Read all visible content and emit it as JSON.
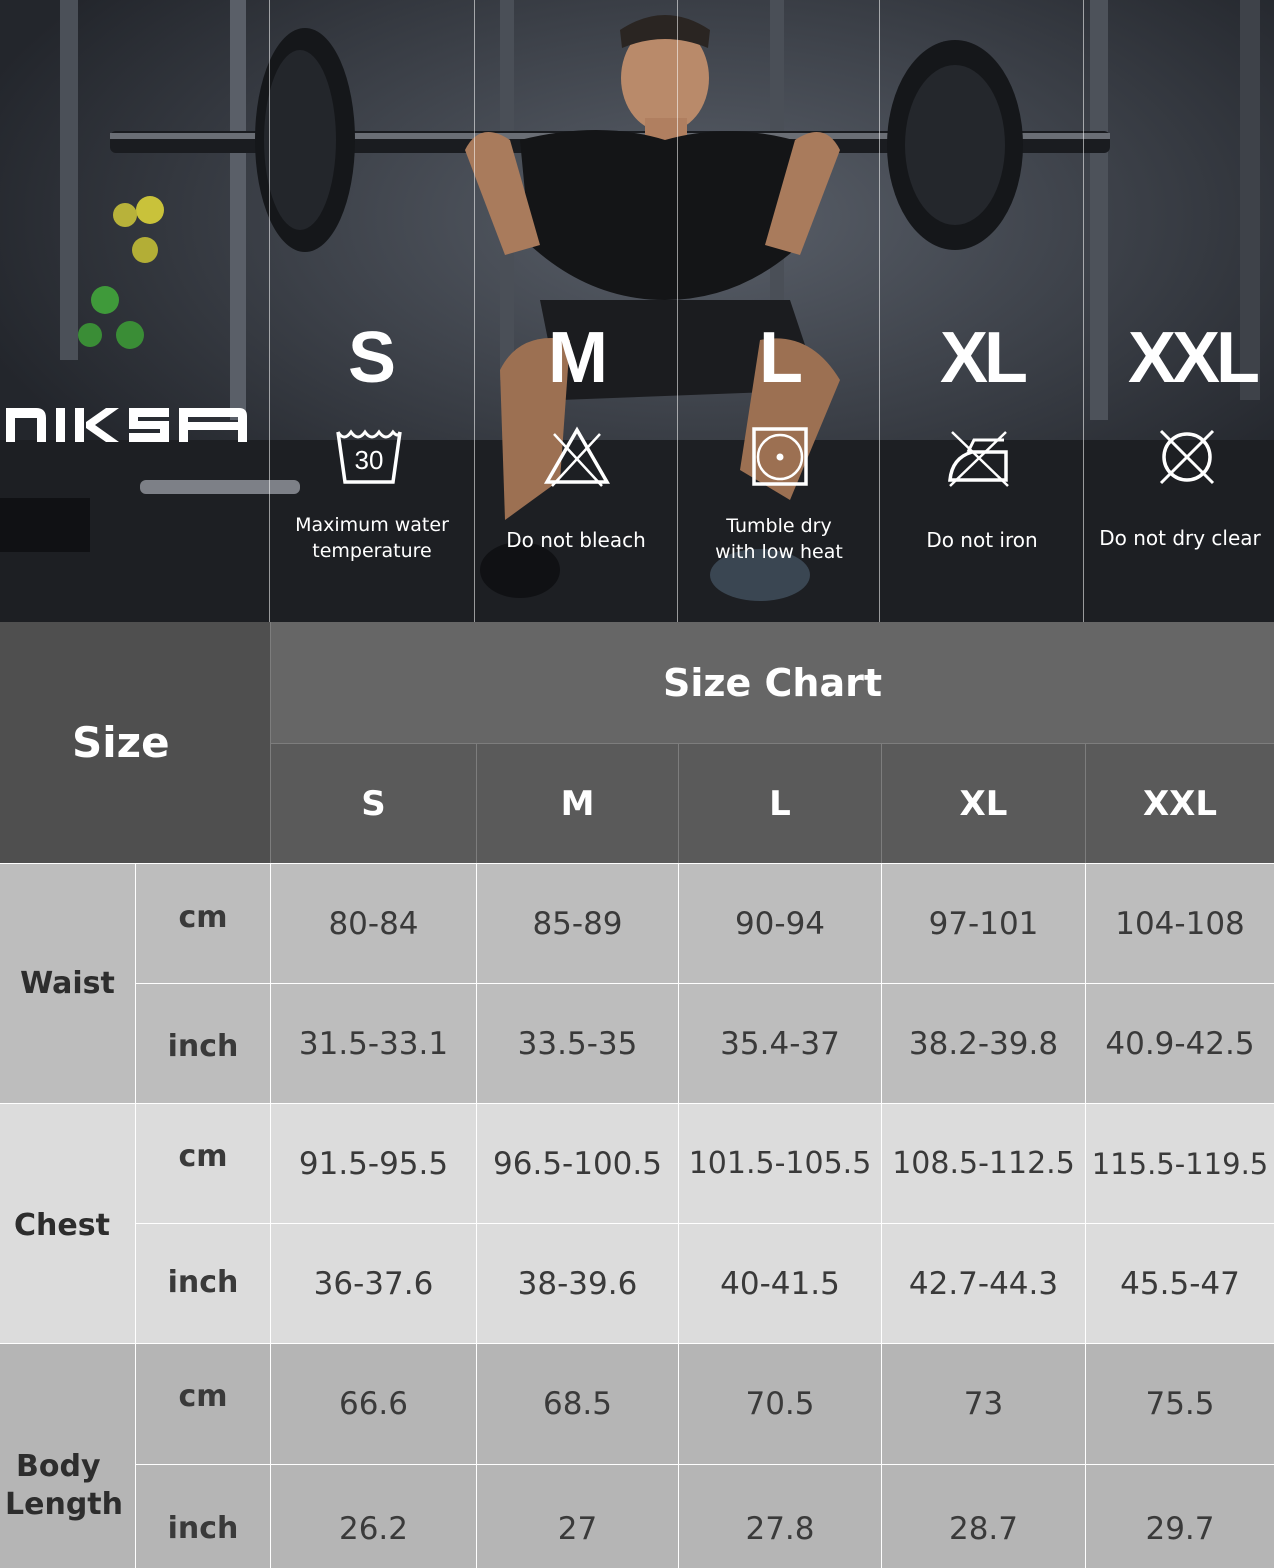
{
  "brand": {
    "logo_text": "NIKSA"
  },
  "hero": {
    "sizes": [
      "S",
      "M",
      "L",
      "XL",
      "XXL"
    ],
    "care": [
      {
        "icon": "wash-30-icon",
        "line1": "Maximum water",
        "line2": "temperature",
        "badge": "30"
      },
      {
        "icon": "do-not-bleach-icon",
        "line1": "Do not bleach",
        "line2": ""
      },
      {
        "icon": "tumble-dry-low-icon",
        "line1": "Tumble dry",
        "line2": "with low heat"
      },
      {
        "icon": "do-not-iron-icon",
        "line1": "Do not iron",
        "line2": ""
      },
      {
        "icon": "do-not-dry-clean-icon",
        "line1": "Do not dry clear",
        "line2": ""
      }
    ]
  },
  "table": {
    "title": "Size Chart",
    "size_label": "Size",
    "columns": [
      "S",
      "M",
      "L",
      "XL",
      "XXL"
    ],
    "groups": [
      {
        "name": "Waist",
        "rows": [
          {
            "unit": "cm",
            "values": [
              "80-84",
              "85-89",
              "90-94",
              "97-101",
              "104-108"
            ]
          },
          {
            "unit": "inch",
            "values": [
              "31.5-33.1",
              "33.5-35",
              "35.4-37",
              "38.2-39.8",
              "40.9-42.5"
            ]
          }
        ]
      },
      {
        "name": "Chest",
        "rows": [
          {
            "unit": "cm",
            "values": [
              "91.5-95.5",
              "96.5-100.5",
              "101.5-105.5",
              "108.5-112.5",
              "115.5-119.5"
            ]
          },
          {
            "unit": "inch",
            "values": [
              "36-37.6",
              "38-39.6",
              "40-41.5",
              "42.7-44.3",
              "45.5-47"
            ]
          }
        ]
      },
      {
        "name_line1": "Body",
        "name_line2": "Length",
        "rows": [
          {
            "unit": "cm",
            "values": [
              "66.6",
              "68.5",
              "70.5",
              "73",
              "75.5"
            ]
          },
          {
            "unit": "inch",
            "values": [
              "26.2",
              "27",
              "27.8",
              "28.7",
              "29.7"
            ]
          }
        ]
      }
    ]
  },
  "colors": {
    "header_dark": "#4f4f4f",
    "header_mid": "#666666",
    "waist_bg": "#bdbdbd",
    "chest_bg": "#dcdcdc",
    "length_bg": "#b5b5b5"
  }
}
